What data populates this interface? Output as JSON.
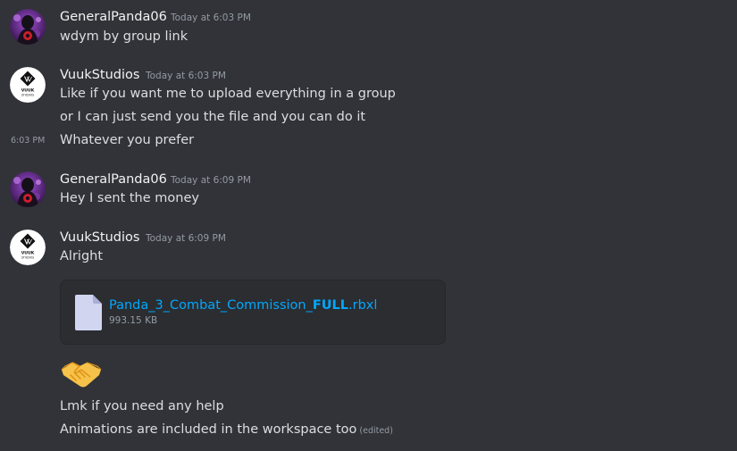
{
  "messages": {
    "group1": {
      "author": "GeneralPanda06",
      "timestamp": "Today at 6:03 PM",
      "lines": [
        "wdym by group link"
      ]
    },
    "group2": {
      "author": "VuukStudios",
      "timestamp": "Today at 6:03 PM",
      "lines": [
        "Like if you want me to upload everything in a group",
        "or I can just send you the file and you can do it",
        "Whatever you prefer"
      ],
      "hover_timestamp": "6:03 PM"
    },
    "group3": {
      "author": "GeneralPanda06",
      "timestamp": "Today at 6:09 PM",
      "lines": [
        "Hey I sent the money"
      ]
    },
    "group4": {
      "author": "VuukStudios",
      "timestamp": "Today at 6:09 PM",
      "lines": [
        "Alright"
      ],
      "attachment": {
        "name_prefix": "Panda_3_Combat_Commission_",
        "name_bold": "FULL",
        "name_ext": ".rbxl",
        "size": "993.15 KB"
      },
      "emoji": "handshake",
      "lines_after": [
        "Lmk if you need any help",
        "Animations are included in the workspace too"
      ],
      "edited_label": "(edited)"
    }
  },
  "avatar_labels": {
    "vuuk_line1": "VUUK",
    "vuuk_line2": "STUDIOS"
  },
  "colors": {
    "background": "#313338",
    "author": "#f2f3f5",
    "text": "#dbdee1",
    "muted": "#949ba4",
    "link": "#00a8fc",
    "attachment_bg": "#2b2d31"
  }
}
